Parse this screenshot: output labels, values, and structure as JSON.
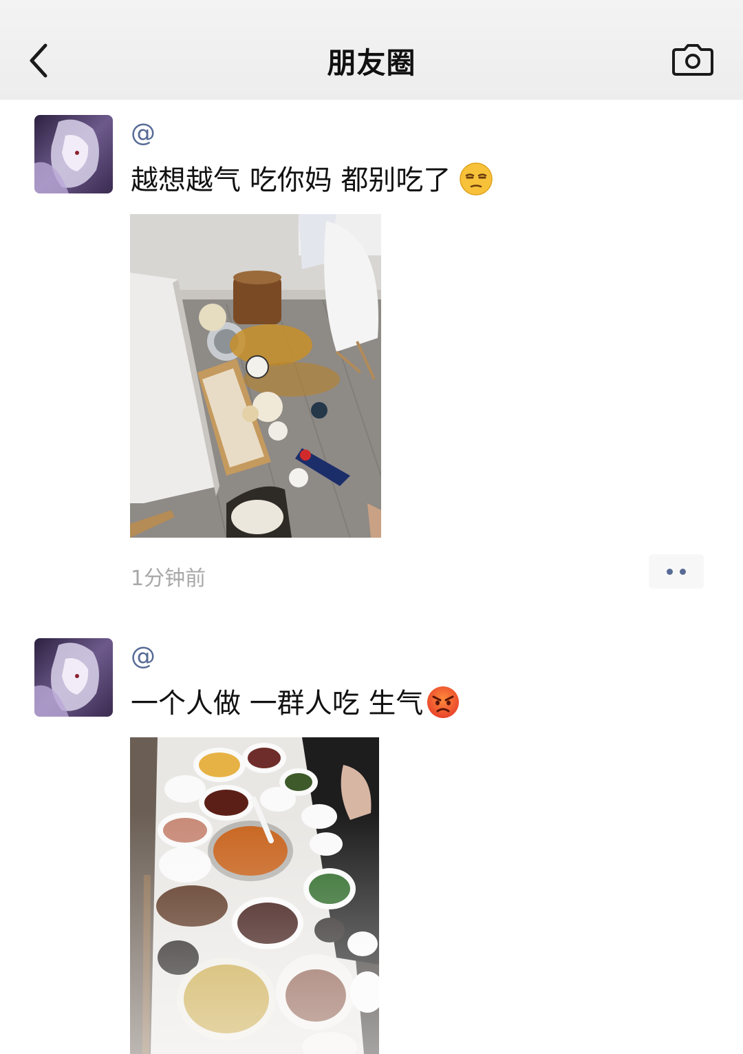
{
  "header": {
    "title": "朋友圈",
    "back_icon": "chevron-left-icon",
    "camera_icon": "camera-icon"
  },
  "posts": [
    {
      "username": "@",
      "text": "越想越气 吃你妈 都别吃了",
      "emoji": "unamused-face-emoji",
      "photo": "overturned-table-spilled-food-photo",
      "timestamp": "1分钟前",
      "more_icon": "more-dots-icon"
    },
    {
      "username": "@",
      "text": "一个人做 一群人吃 生气",
      "emoji": "angry-face-emoji",
      "photo": "dinner-table-dishes-photo"
    }
  ],
  "colors": {
    "link": "#576b95",
    "header_bg": "#ededed",
    "timestamp": "#a8a8a8"
  }
}
